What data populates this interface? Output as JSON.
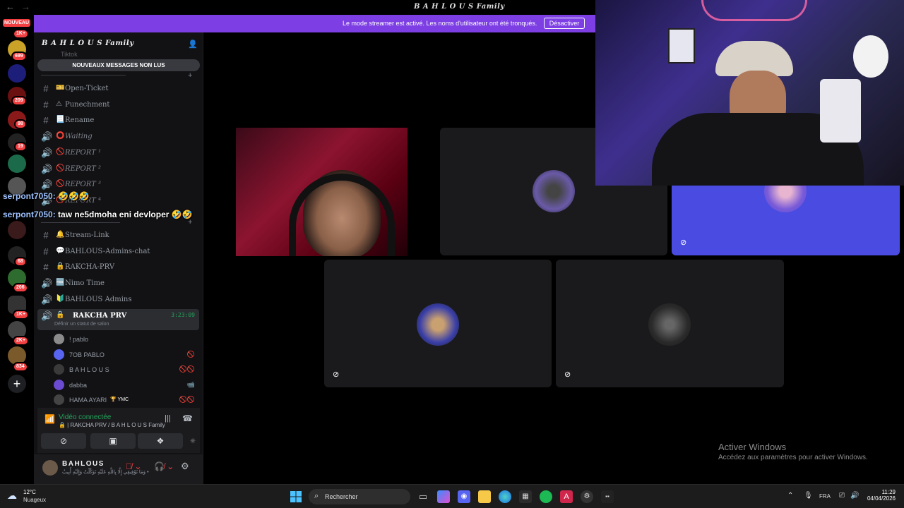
{
  "window": {
    "title": "𝘽 𝘼 𝙃 𝙇 𝙊 𝙐 𝙎 Family",
    "title_display": "B A H L O U S Family"
  },
  "banner": {
    "message": "Le mode streamer est activé. Les noms d'utilisateur ont été tronqués.",
    "button": "Désactiver"
  },
  "rail": {
    "nouveau": "NOUVEAU",
    "badges": [
      "1K+",
      "699",
      "209",
      "98",
      "19",
      "68",
      "206",
      "1K+",
      "2K+",
      "834"
    ]
  },
  "server": {
    "name": "B A H L O U S Family",
    "ghost_channel": "Tiktok",
    "unread_pill": "NOUVEAUX MESSAGES NON LUS",
    "channels_top": [
      {
        "icon": "#",
        "emoji": "🎫",
        "name": "Open-Ticket",
        "italic": false
      },
      {
        "icon": "#",
        "emoji": "⚠",
        "name": "Punechment",
        "italic": false
      },
      {
        "icon": "#",
        "emoji": "📃",
        "name": "Rename",
        "italic": false
      },
      {
        "icon": "🔊",
        "emoji": "⭕",
        "name": "Waiting",
        "italic": true
      },
      {
        "icon": "🔊",
        "emoji": "🚫",
        "name": "REPORT ¹",
        "italic": true
      },
      {
        "icon": "🔊",
        "emoji": "🚫",
        "name": "REPORT ²",
        "italic": true
      },
      {
        "icon": "🔊",
        "emoji": "🚫",
        "name": "REPORT ³",
        "italic": true
      },
      {
        "icon": "🔊",
        "emoji": "🚫",
        "name": "REPORT ⁴",
        "italic": true
      }
    ],
    "channels_bottom": [
      {
        "icon": "#",
        "emoji": "🔔",
        "name": "Stream-Link"
      },
      {
        "icon": "#",
        "emoji": "💬",
        "name": "BAHLOUS-Admins-chat"
      },
      {
        "icon": "#",
        "emoji": "🔒",
        "name": "RAKCHA-PRV"
      },
      {
        "icon": "🔊",
        "emoji": "🆓",
        "name": "Nimo Time"
      },
      {
        "icon": "🔊",
        "emoji": "🔰",
        "name": "BAHLOUS Admins"
      }
    ],
    "active_channel": {
      "icon": "🔊",
      "emoji": "🔒",
      "name": "RAKCHA PRV",
      "timer": "3:23:09",
      "status": "Définir un statut de salon"
    },
    "voice_users": [
      {
        "name": "! pablo",
        "icons": "",
        "color": "#8b8b8b"
      },
      {
        "name": "7OB PABLO",
        "icons": "🚫",
        "color": "#5865f2"
      },
      {
        "name": "B A H L O U S",
        "icons": "🚫🚫",
        "color": "#3a3a3a"
      },
      {
        "name": "dabba",
        "icons": "📹",
        "color": "#6a4bd1"
      },
      {
        "name": "HAMA AYARI",
        "tag": "🏆 YMC",
        "icons": "🚫🚫",
        "color": "#444"
      }
    ]
  },
  "voice_panel": {
    "status": "Vidéo connectée",
    "location": "🔒 | RAKCHA PRV / B A H L O U S Family"
  },
  "user": {
    "name": "BAHLOUS",
    "status": "وَمَا تَوْفِيقِي إِلَّا بِاللَّهِ عَلَيْهِ تَوَكَّلْتُ وَإِلَيْهِ أُنِيبُ •"
  },
  "chat_overlay": [
    {
      "user": "serpont7050:",
      "text": " 🤣🤣🤣"
    },
    {
      "user": "serpont7050:",
      "text": " taw ne5dmoha eni devloper 🤣🤣"
    }
  ],
  "watermark": {
    "title": "Activer Windows",
    "subtitle": "Accédez aux paramètres pour activer Windows."
  },
  "taskbar": {
    "temp": "12°C",
    "condition": "Nuageux",
    "search": "Rechercher",
    "lang": "FRA",
    "time": "11:29",
    "date": "04/04/2026"
  }
}
